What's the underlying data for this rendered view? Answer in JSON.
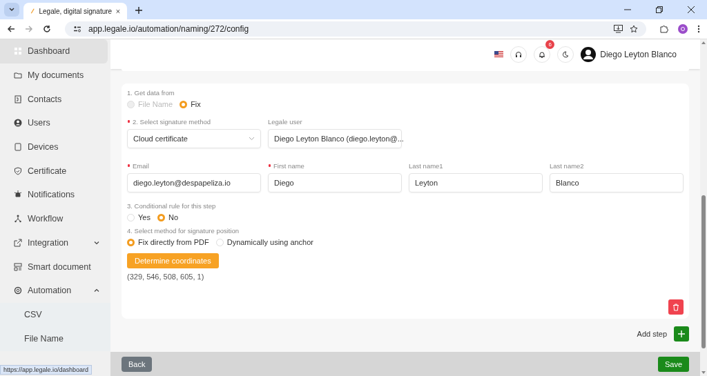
{
  "browser": {
    "tab_title": "Legale, digital signature",
    "url": "app.legale.io/automation/naming/272/config",
    "status_url": "https://app.legale.io/dashboard"
  },
  "sidebar": {
    "items": [
      {
        "label": "Dashboard",
        "selected": true
      },
      {
        "label": "My documents",
        "selected": false
      },
      {
        "label": "Contacts",
        "selected": false
      },
      {
        "label": "Users",
        "selected": false
      },
      {
        "label": "Devices",
        "selected": false
      },
      {
        "label": "Certificate",
        "selected": false
      },
      {
        "label": "Notifications",
        "selected": false
      },
      {
        "label": "Workflow",
        "selected": false
      },
      {
        "label": "Integration",
        "selected": false,
        "expanded": false
      },
      {
        "label": "Smart document",
        "selected": false
      },
      {
        "label": "Automation",
        "selected": false,
        "expanded": true,
        "children": [
          {
            "label": "CSV",
            "selected": false
          },
          {
            "label": "File Name",
            "selected": false
          }
        ]
      }
    ]
  },
  "header": {
    "notification_count": "6",
    "user_name": "Diego Leyton Blanco"
  },
  "step": {
    "source": {
      "label": "1. Get data from",
      "options": [
        {
          "label": "File Name",
          "selected": false,
          "disabled": true
        },
        {
          "label": "Fix",
          "selected": true,
          "disabled": false
        }
      ]
    },
    "fields": [
      {
        "kind": "select",
        "label": "2. Select signature method",
        "required": true,
        "value": "Cloud certificate"
      },
      {
        "kind": "select",
        "label": "Legale user",
        "required": false,
        "value": "Diego Leyton Blanco (diego.leyton@..."
      },
      {
        "kind": "break"
      },
      {
        "kind": "input",
        "label": "Email",
        "required": true,
        "value": "diego.leyton@despapeliza.io"
      },
      {
        "kind": "input",
        "label": "First name",
        "required": true,
        "value": "Diego"
      },
      {
        "kind": "input",
        "label": "Last name1",
        "required": false,
        "value": "Leyton"
      },
      {
        "kind": "input",
        "label": "Last name2",
        "required": false,
        "value": "Blanco"
      }
    ],
    "condition": {
      "label": "3. Conditional rule for this step",
      "options": [
        {
          "label": "Yes",
          "selected": false,
          "disabled": false
        },
        {
          "label": "No",
          "selected": true,
          "disabled": false
        }
      ]
    },
    "position": {
      "label": "4. Select method for signature position",
      "options": [
        {
          "label": "Fix directly from PDF",
          "selected": true,
          "disabled": false
        },
        {
          "label": "Dynamically using anchor",
          "selected": false,
          "disabled": false
        }
      ]
    },
    "coordinates_button": "Determine coordinates",
    "coordinates": "(329, 546, 508, 605, 1)"
  },
  "add_step": "Add step",
  "footer": {
    "back": "Back",
    "save": "Save"
  }
}
